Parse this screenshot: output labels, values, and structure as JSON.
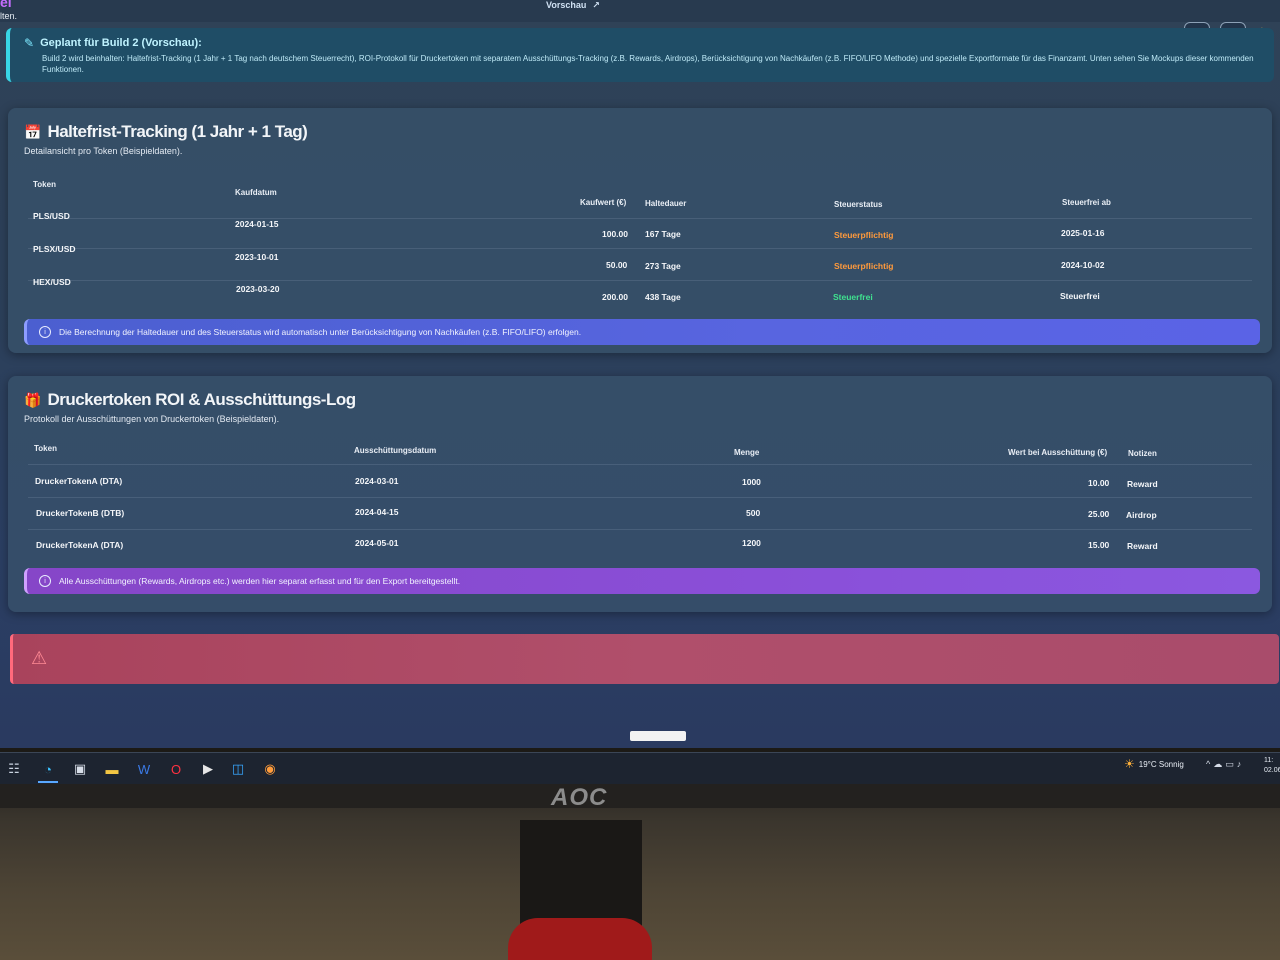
{
  "top": {
    "brand_fragment": "el",
    "left_fragment": "lten.",
    "preview_label": "Vorschau",
    "preview_icon": "external-link-icon",
    "icons": [
      "feedback-icon",
      "globe-icon",
      "sun-icon"
    ]
  },
  "notice": {
    "icon": "edit-icon",
    "title": "Geplant für Build 2 (Vorschau):",
    "body": "Build 2 wird beinhalten: Haltefrist-Tracking (1 Jahr + 1 Tag nach deutschem Steuerrecht), ROI-Protokoll für Druckertoken mit separatem Ausschüttungs-Tracking (z.B. Rewards, Airdrops), Berücksichtigung von Nachkäufen (z.B. FIFO/LIFO Methode) und spezielle Exportformate für das Finanzamt. Unten sehen Sie Mockups dieser kommenden Funktionen."
  },
  "holding": {
    "icon": "calendar-check-icon",
    "title": "Haltefrist-Tracking (1 Jahr + 1 Tag)",
    "subtitle": "Detailansicht pro Token (Beispieldaten).",
    "headers": [
      "Token",
      "Kaufdatum",
      "Kaufwert (€)",
      "Haltedauer",
      "Steuerstatus",
      "Steuerfrei ab"
    ],
    "rows": [
      {
        "token": "PLS/USD",
        "date": "2024-01-15",
        "value": "100.00",
        "duration": "167 Tage",
        "status": "Steuerpflichtig",
        "free_from": "2025-01-16"
      },
      {
        "token": "PLSX/USD",
        "date": "2023-10-01",
        "value": "50.00",
        "duration": "273 Tage",
        "status": "Steuerpflichtig",
        "free_from": "2024-10-02"
      },
      {
        "token": "HEX/USD",
        "date": "2023-03-20",
        "value": "200.00",
        "duration": "438 Tage",
        "status": "Steuerfrei",
        "free_from": "Steuerfrei"
      }
    ],
    "info": "Die Berechnung der Haltedauer und des Steuerstatus wird automatisch unter Berücksichtigung von Nachkäufen (z.B. FIFO/LIFO) erfolgen."
  },
  "printer": {
    "icon": "gift-icon",
    "title": "Druckertoken ROI & Ausschüttungs-Log",
    "subtitle": "Protokoll der Ausschüttungen von Druckertoken (Beispieldaten).",
    "headers": [
      "Token",
      "Ausschüttungsdatum",
      "Menge",
      "Wert bei Ausschüttung (€)",
      "Notizen"
    ],
    "rows": [
      {
        "token": "DruckerTokenA (DTA)",
        "date": "2024-03-01",
        "amount": "1000",
        "value": "10.00",
        "note": "Reward"
      },
      {
        "token": "DruckerTokenB (DTB)",
        "date": "2024-04-15",
        "amount": "500",
        "value": "25.00",
        "note": "Airdrop"
      },
      {
        "token": "DruckerTokenA (DTA)",
        "date": "2024-05-01",
        "amount": "1200",
        "value": "15.00",
        "note": "Reward"
      }
    ],
    "info": "Alle Ausschüttungen (Rewards, Airdrops etc.) werden hier separat erfasst und für den Export bereitgestellt."
  },
  "alert": {
    "icon": "warning-triangle-icon"
  },
  "taskbar": {
    "apps": [
      "taskview-icon",
      "edge-icon",
      "store-icon",
      "file-explorer-icon",
      "word-icon",
      "opera-icon",
      "media-player-icon",
      "app-icon",
      "app-icon"
    ],
    "weather": "19°C Sonnig",
    "clock_time": "11:",
    "clock_date": "02.06"
  },
  "monitor": {
    "brand": "AOC"
  }
}
